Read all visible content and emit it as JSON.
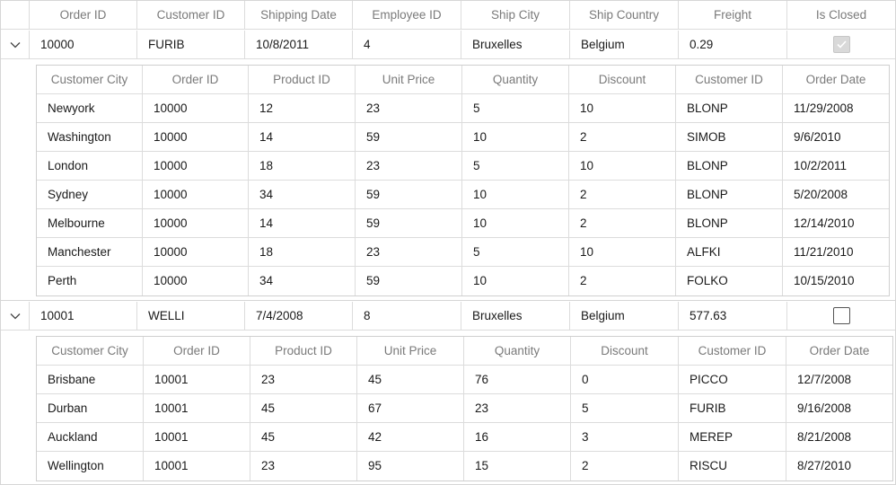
{
  "master_columns": [
    "Order ID",
    "Customer ID",
    "Shipping Date",
    "Employee ID",
    "Ship City",
    "Ship Country",
    "Freight",
    "Is Closed"
  ],
  "detail_columns": [
    "Customer City",
    "Order ID",
    "Product ID",
    "Unit Price",
    "Quantity",
    "Discount",
    "Customer ID",
    "Order Date"
  ],
  "orders": [
    {
      "values": [
        "10000",
        "FURIB",
        "10/8/2011",
        "4",
        "Bruxelles",
        "Belgium",
        "0.29"
      ],
      "is_closed": true,
      "details": [
        [
          "Newyork",
          "10000",
          "12",
          "23",
          "5",
          "10",
          "BLONP",
          "11/29/2008"
        ],
        [
          "Washington",
          "10000",
          "14",
          "59",
          "10",
          "2",
          "SIMOB",
          "9/6/2010"
        ],
        [
          "London",
          "10000",
          "18",
          "23",
          "5",
          "10",
          "BLONP",
          "10/2/2011"
        ],
        [
          "Sydney",
          "10000",
          "34",
          "59",
          "10",
          "2",
          "BLONP",
          "5/20/2008"
        ],
        [
          "Melbourne",
          "10000",
          "14",
          "59",
          "10",
          "2",
          "BLONP",
          "12/14/2010"
        ],
        [
          "Manchester",
          "10000",
          "18",
          "23",
          "5",
          "10",
          "ALFKI",
          "11/21/2010"
        ],
        [
          "Perth",
          "10000",
          "34",
          "59",
          "10",
          "2",
          "FOLKO",
          "10/15/2010"
        ]
      ]
    },
    {
      "values": [
        "10001",
        "WELLI",
        "7/4/2008",
        "8",
        "Bruxelles",
        "Belgium",
        "577.63"
      ],
      "is_closed": false,
      "details": [
        [
          "Brisbane",
          "10001",
          "23",
          "45",
          "76",
          "0",
          "PICCO",
          "12/7/2008"
        ],
        [
          "Durban",
          "10001",
          "45",
          "67",
          "23",
          "5",
          "FURIB",
          "9/16/2008"
        ],
        [
          "Auckland",
          "10001",
          "45",
          "42",
          "16",
          "3",
          "MEREP",
          "8/21/2008"
        ],
        [
          "Wellington",
          "10001",
          "23",
          "95",
          "15",
          "2",
          "RISCU",
          "8/27/2010"
        ]
      ]
    }
  ]
}
